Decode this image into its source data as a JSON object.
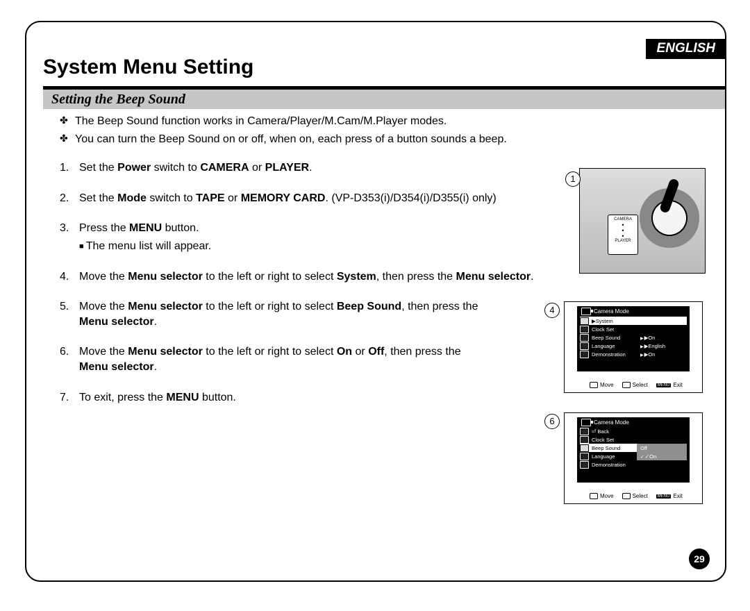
{
  "language_tag": "ENGLISH",
  "page_title": "System Menu Setting",
  "subtitle": "Setting the Beep Sound",
  "page_number": "29",
  "bullets": [
    "The Beep Sound function works in Camera/Player/M.Cam/M.Player modes.",
    "You can turn the Beep Sound on or off, when on, each press of a button sounds a beep."
  ],
  "steps": {
    "s1_num": "1.",
    "s1_a": "Set the ",
    "s1_b": "Power",
    "s1_c": " switch to ",
    "s1_d": "CAMERA",
    "s1_e": " or ",
    "s1_f": "PLAYER",
    "s1_g": ".",
    "s2_num": "2.",
    "s2_a": "Set the ",
    "s2_b": "Mode",
    "s2_c": " switch to ",
    "s2_d": "TAPE",
    "s2_e": " or ",
    "s2_f": "MEMORY CARD",
    "s2_g": ". (VP-D353(i)/D354(i)/D355(i) only)",
    "s3_num": "3.",
    "s3_a": "Press the ",
    "s3_b": "MENU",
    "s3_c": " button.",
    "s3_sub": "The menu list will appear.",
    "s4_num": "4.",
    "s4_a": "Move the ",
    "s4_b": "Menu selector",
    "s4_c": " to the left or right to select ",
    "s4_d": "System",
    "s4_e": ", then press the ",
    "s4_f": "Menu selector",
    "s4_g": ".",
    "s5_num": "5.",
    "s5_a": "Move the ",
    "s5_b": "Menu selector",
    "s5_c": " to the left or right to select ",
    "s5_d": "Beep Sound",
    "s5_e": ", then press the ",
    "s5_f": "Menu selector",
    "s5_g": ".",
    "s6_num": "6.",
    "s6_a": "Move the ",
    "s6_b": "Menu selector",
    "s6_c": " to the left or right to select ",
    "s6_d": "On",
    "s6_e": " or ",
    "s6_f": "Off",
    "s6_g": ", then press the ",
    "s6_h": "Menu selector",
    "s6_i": ".",
    "s7_num": "7.",
    "s7_a": "To exit, press the ",
    "s7_b": "MENU",
    "s7_c": " button."
  },
  "fig1": {
    "badge": "1",
    "label_top": "CAMERA",
    "label_bottom": "PLAYER"
  },
  "fig4": {
    "badge": "4",
    "mode": "Camera Mode",
    "rows": [
      {
        "label": "▶System",
        "val": "",
        "sel": true
      },
      {
        "label": "Clock Set",
        "val": ""
      },
      {
        "label": "Beep Sound",
        "val": "▶On"
      },
      {
        "label": "Language",
        "val": "▶English"
      },
      {
        "label": "Demonstration",
        "val": "▶On"
      }
    ],
    "foot_move": "Move",
    "foot_select": "Select",
    "foot_menu": "MENU",
    "foot_exit": "Exit"
  },
  "fig6": {
    "badge": "6",
    "mode": "Camera Mode",
    "back": "Back",
    "rows": [
      {
        "label": "Clock Set",
        "val": ""
      },
      {
        "label": "Beep Sound",
        "val": "Off",
        "sel": true
      },
      {
        "label": "Language",
        "val": "✓On",
        "valband": true
      },
      {
        "label": "Demonstration",
        "val": ""
      }
    ],
    "foot_move": "Move",
    "foot_select": "Select",
    "foot_menu": "MENU",
    "foot_exit": "Exit"
  }
}
